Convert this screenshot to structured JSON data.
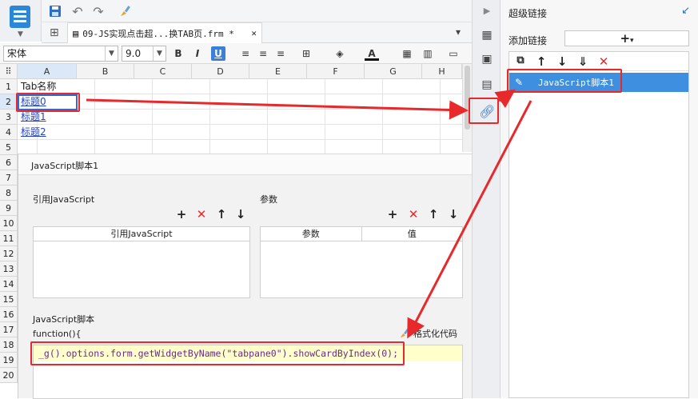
{
  "tab": {
    "title": "09-JS实现点击超...换TAB页.frm *",
    "close": "✕"
  },
  "format": {
    "font": "宋体",
    "size": "9.0",
    "bold": "B",
    "italic": "I",
    "underline": "U",
    "fontcolor": "A"
  },
  "sheet": {
    "columns": [
      "A",
      "B",
      "C",
      "D",
      "E",
      "F",
      "G",
      "H"
    ],
    "rows": [
      "1",
      "2",
      "3",
      "4",
      "5",
      "6",
      "7",
      "8",
      "9",
      "10",
      "11",
      "12",
      "13",
      "14",
      "15",
      "16",
      "17",
      "18",
      "19",
      "20"
    ],
    "a1": "Tab名称",
    "a2": "标题0",
    "a3": "标题1",
    "a4": "标题2"
  },
  "dialog": {
    "title": "JavaScript脚本1",
    "ref_group": "引用JavaScript",
    "param_group": "参数",
    "ref_col": "引用JavaScript",
    "param_col1": "参数",
    "param_col2": "值",
    "script_label": "JavaScript脚本",
    "func_line": "function(){",
    "format_code": "格式化代码",
    "code": "_g().options.form.getWidgetByName(\"tabpane0\").showCardByIndex(0);"
  },
  "right": {
    "title": "超级链接",
    "add_label": "添加链接",
    "add_btn": "+",
    "item": "JavaScript脚本1"
  },
  "colors": {
    "accent": "#2d87d8",
    "selected": "#3f8fe0",
    "annotation": "#e8292c"
  }
}
